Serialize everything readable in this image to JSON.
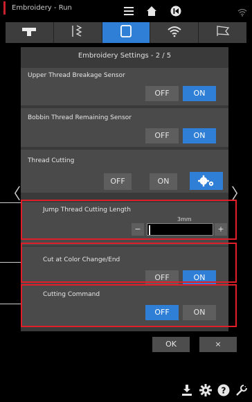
{
  "app_title": "Embroidery - Run",
  "panel_title": "Embroidery Settings - 2 / 5",
  "upper_thread": {
    "label": "Upper Thread Breakage Sensor",
    "off": "OFF",
    "on": "ON"
  },
  "bobbin_thread": {
    "label": "Bobbin Thread Remaining Sensor",
    "off": "OFF",
    "on": "ON"
  },
  "thread_cutting": {
    "label": "Thread Cutting",
    "off": "OFF",
    "on": "ON"
  },
  "jump_thread": {
    "label": "Jump Thread Cutting Length",
    "value": "3mm",
    "minus": "−",
    "plus": "+"
  },
  "color_change": {
    "label": "Cut at Color Change/End",
    "off": "OFF",
    "on": "ON"
  },
  "cutting_command": {
    "label": "Cutting Command",
    "off": "OFF",
    "on": "ON"
  },
  "dialog": {
    "ok": "OK",
    "cancel": "×"
  },
  "nav": {
    "left": "〈",
    "right": "〉"
  },
  "colors": {
    "accent": "#2f7fd6",
    "highlight": "#e01e2a",
    "panel": "#3a3a3a"
  }
}
